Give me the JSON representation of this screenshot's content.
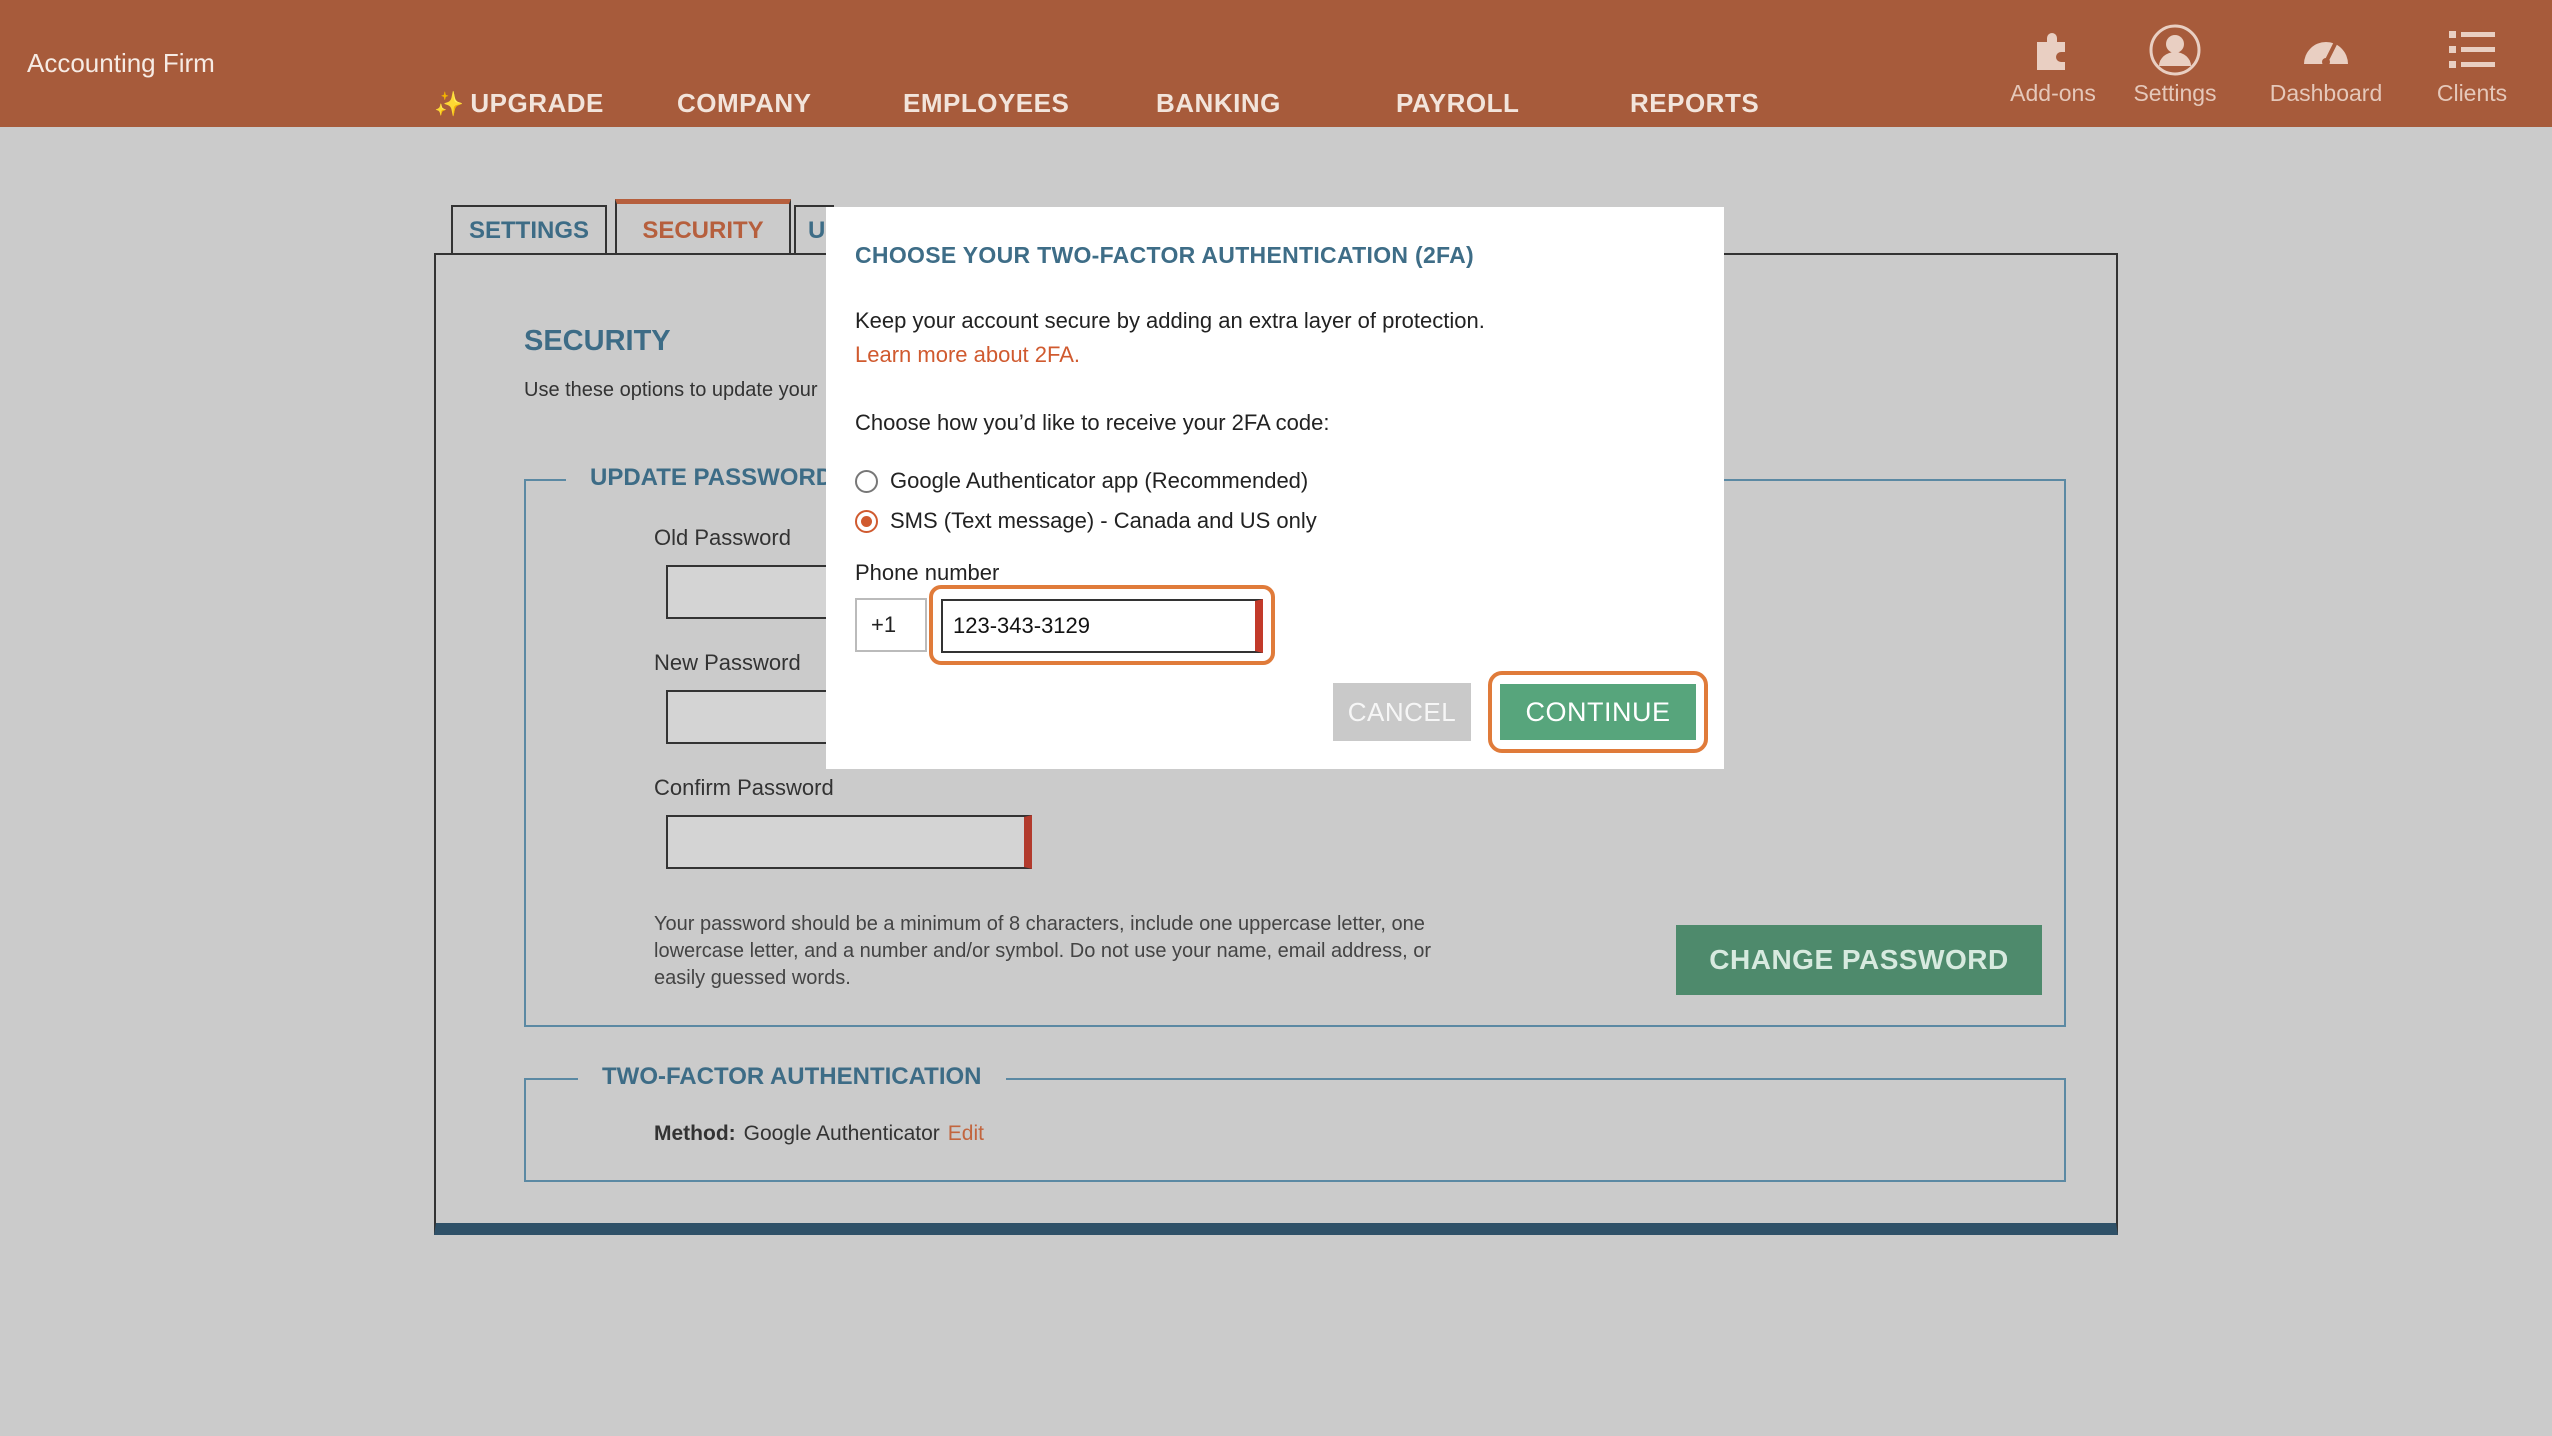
{
  "app": {
    "brand": "Accounting Firm"
  },
  "nav": {
    "upgrade": "UPGRADE",
    "company": "COMPANY",
    "employees": "EMPLOYEES",
    "banking": "BANKING",
    "payroll": "PAYROLL",
    "reports": "REPORTS"
  },
  "tools": {
    "addons": "Add-ons",
    "settings": "Settings",
    "dashboard": "Dashboard",
    "clients": "Clients"
  },
  "tabs": {
    "settings": "SETTINGS",
    "security": "SECURITY",
    "third": "U"
  },
  "security": {
    "title": "SECURITY",
    "description": "Use these options to update your",
    "update_password": {
      "legend": "UPDATE PASSWORD",
      "old_label": "Old Password",
      "new_label": "New Password",
      "confirm_label": "Confirm Password",
      "hint": "Your password should be a minimum of 8 characters, include one uppercase letter, one lowercase letter, and a number and/or symbol. Do not use your name, email address, or easily guessed words.",
      "change_button": "CHANGE PASSWORD"
    },
    "twofa": {
      "legend": "TWO-FACTOR AUTHENTICATION",
      "method_label": "Method:",
      "method_value": "Google Authenticator",
      "edit": "Edit"
    }
  },
  "modal": {
    "title": "CHOOSE YOUR TWO-FACTOR AUTHENTICATION (2FA)",
    "intro": "Keep your account secure by adding an extra layer of protection.",
    "learn_more": "Learn more about 2FA.",
    "prompt": "Choose how you’d like to receive your 2FA code:",
    "options": [
      {
        "label": "Google Authenticator app (Recommended)",
        "selected": false
      },
      {
        "label": "SMS (Text message) - Canada and US only",
        "selected": true
      }
    ],
    "phone_label": "Phone number",
    "country_code": "+1",
    "phone_value": "123-343-3129",
    "cancel": "CANCEL",
    "continue": "CONTINUE"
  },
  "colors": {
    "topbar": "#a75b3b",
    "accent_orange": "#e07b3a",
    "heading_blue": "#3d6c86",
    "continue_green": "#57a57c",
    "change_green": "#4e8a6c"
  }
}
